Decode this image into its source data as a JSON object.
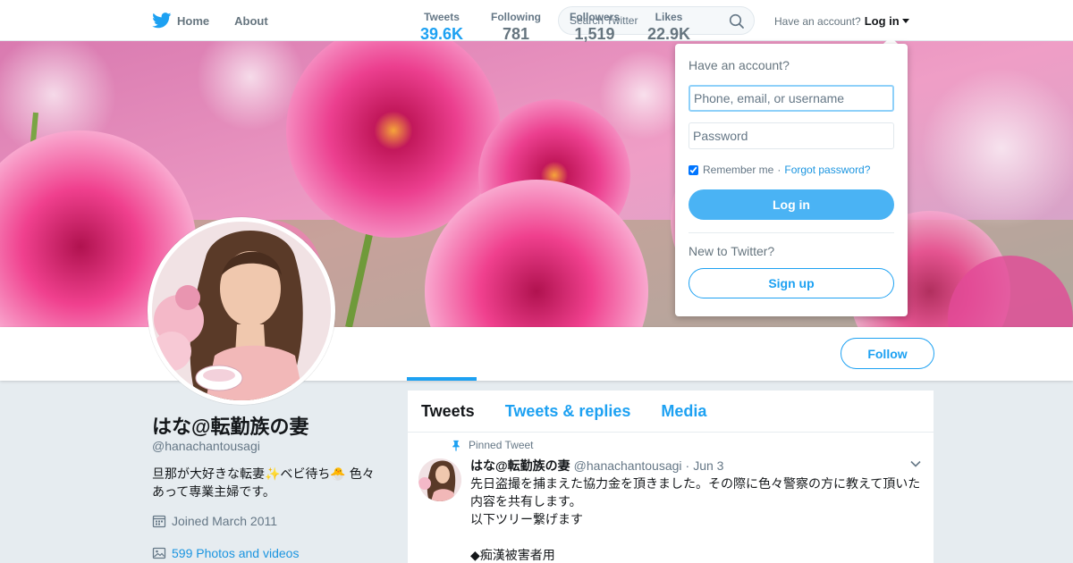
{
  "nav": {
    "home_label": "Home",
    "about_label": "About",
    "search_placeholder": "Search Twitter",
    "account_prompt": "Have an account?",
    "login_label": "Log in"
  },
  "profile": {
    "name": "はな@転勤族の妻",
    "handle": "@hanachantousagi",
    "bio_line1": "旦那が大好きな転妻✨ベビ待ち🐣 色々",
    "bio_line2": "あって専業主婦です。",
    "joined": "Joined March 2011",
    "photos": "599 Photos and videos",
    "follow_label": "Follow"
  },
  "stats": [
    {
      "label": "Tweets",
      "value": "39.6K"
    },
    {
      "label": "Following",
      "value": "781"
    },
    {
      "label": "Followers",
      "value": "1,519"
    },
    {
      "label": "Likes",
      "value": "22.9K"
    }
  ],
  "timeline": {
    "tabs": [
      "Tweets",
      "Tweets & replies",
      "Media"
    ],
    "pinned_label": "Pinned Tweet",
    "tweet": {
      "name": "はな@転勤族の妻",
      "handle": "@hanachantousagi",
      "separator": "·",
      "date": "Jun 3",
      "lines": [
        "先日盗撮を捕まえた協力金を頂きました。その際に色々警察の方に教えて頂いた",
        "内容を共有します。",
        "以下ツリー繋げます",
        "",
        "◆痴漢被害者用"
      ]
    }
  },
  "login_dropdown": {
    "title": "Have an account?",
    "username_placeholder": "Phone, email, or username",
    "password_placeholder": "Password",
    "remember_label": "Remember me",
    "separator": "·",
    "forgot_label": "Forgot password?",
    "login_button": "Log in",
    "new_prompt": "New to Twitter?",
    "signup_button": "Sign up"
  },
  "colors": {
    "accent": "#1da1f2",
    "login_button": "#4ab3f4",
    "link": "#1b95e0",
    "banner_pink": "#e84a9a"
  }
}
